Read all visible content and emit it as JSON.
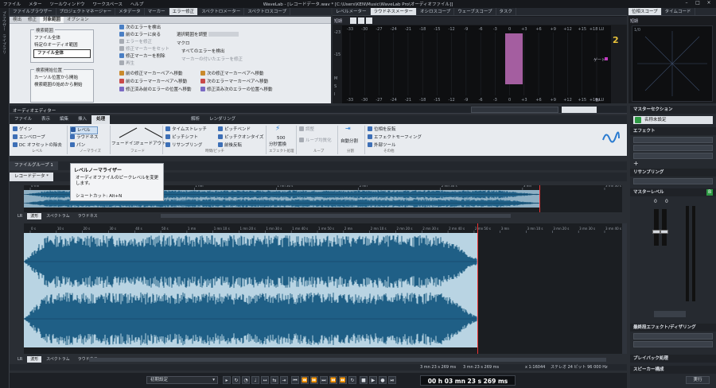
{
  "titlebar": {
    "menu": [
      "ファイル",
      "メター",
      "ツールウィンドウ",
      "ワークスペース",
      "ヘルプ"
    ],
    "title": "WaveLab - [レコードデータ.wav * [C:\\Users\\KEN\\Music\\WaveLab Pro\\オーディオファイル]]"
  },
  "leftrail": {
    "labels": [
      "ブラウザー",
      "ライブラリ"
    ]
  },
  "toppanel": {
    "tabs": [
      "ファイルブラウザー",
      "プロジェクトマネージャー",
      "メタデータ",
      "マーカー",
      "エラー修正",
      "スペクトロメーター",
      "スペクトロスコープ"
    ],
    "active_tab": "エラー修正",
    "subtabs": [
      "検出",
      "修正",
      "対象範囲",
      "オプション"
    ],
    "active_subtab": "対象範囲",
    "group1_title": "検索範囲",
    "group1_items": [
      "ファイル全体",
      "特定のオーディオ範囲",
      "ファイル全体"
    ],
    "group2_title": "検索開始位置",
    "group2_items": [
      "カーソル位置から開始",
      "検索範囲の始めから開始"
    ],
    "cmds_col1": [
      "次のエラーを検出",
      "前のエラーに戻る",
      "エラーを修正",
      "修正マーカーをセット",
      "修正マーカーを削除",
      "再生"
    ],
    "cmds_col2": [
      "選択範囲を調整",
      "マクロ",
      "すべてのエラーを検出",
      "マーカーの付いたエラーを修正"
    ],
    "cmds_bottom": [
      "前の修正マーカーペアへ移動",
      "次の修正マーカーペアへ移動",
      "前のエラーマーカーペアへ移動",
      "次のエラーマーカーペアへ移動",
      "修正済み前のエラーの位置へ移動",
      "修正済み次のエラーの位置へ移動"
    ]
  },
  "levelpanel": {
    "tabs": [
      "レベルメーター",
      "ラウドネスメーター",
      "オシロスコープ",
      "ウェーブスコープ",
      "タスク"
    ],
    "active_tab": "ラウドネスメーター",
    "label": "短期",
    "scale": [
      "-33",
      "-30",
      "-27",
      "-24",
      "-21",
      "-18",
      "-15",
      "-12",
      "-9",
      "-6",
      "-3",
      "0",
      "+3",
      "+6",
      "+9",
      "+12",
      "+15",
      "+18 LU"
    ],
    "gate": "ゲート",
    "lufs_badge": "2",
    "left_labels": [
      "-23",
      "-15",
      "M",
      "S",
      "I"
    ],
    "tp": "TP"
  },
  "phasepanel": {
    "tabs": [
      "位相スコープ",
      "タイムコード"
    ],
    "label": "短期",
    "value": "1/0"
  },
  "editor": {
    "title": "オーディオエディター",
    "ribbon_tabs": [
      "ファイル",
      "表示",
      "編集",
      "挿入",
      "処理",
      "解析",
      "レンダリング"
    ],
    "active_ribbon_tab": "処理",
    "ribbon_groups": [
      "レベル",
      "ノーマライズ",
      "フェード",
      "時間/ピッチ",
      "エフェクト処理",
      "ループ",
      "分割",
      "その他"
    ],
    "ribbon_items": {
      "level": [
        "ゲイン",
        "エンベロープ",
        "DC オフセットの除去"
      ],
      "normalize": [
        "レベル",
        "ラウドネス",
        "パン"
      ],
      "fade": [
        "フェードイン",
        "フェードアウト"
      ],
      "time": [
        "タイムストレッチ",
        "ピッチシフト",
        "リサンプリング"
      ],
      "pitch": [
        "ピッチベンド",
        "ピッチクオンタイズ",
        "前後反転"
      ],
      "effect": [
        "500",
        "分秒置換"
      ],
      "loop": [
        "調整",
        "ループ均質化"
      ],
      "split": [
        "自動分割"
      ],
      "other": [
        "位相を反転",
        "エフェクトモーフィング",
        "外部ツール"
      ]
    },
    "tooltip": {
      "title": "レベルノーマライザー",
      "desc": "オーディオファイルのピークレベルを変更します。",
      "shortcut": "ショートカット: Alt+N"
    },
    "file_group_tab": "ファイルグループ 1",
    "file_tab": "レコードデータ *",
    "overview_ticks": [
      "0 mn",
      "30 s",
      "1 mn",
      "1 mn 30 s",
      "2 mn",
      "2 mn 30 s",
      "3 mn",
      "3 mn 30 s"
    ],
    "main_ticks": [
      "0 s",
      "10 s",
      "20 s",
      "30 s",
      "40 s",
      "50 s",
      "1 mn",
      "1 mn 10 s",
      "1 mn 20 s",
      "1 mn 30 s",
      "1 mn 40 s",
      "1 mn 50 s",
      "2 mn",
      "2 mn 10 s",
      "2 mn 20 s",
      "2 mn 30 s",
      "2 mn 40 s",
      "2 mn 50 s",
      "3 mn",
      "3 mn 10 s",
      "3 mn 20 s",
      "3 mn 30 s",
      "3 mn 40 s"
    ],
    "view_tabs": [
      "波形",
      "スペクトラム",
      "ラウドネス"
    ],
    "active_view_tab": "波形",
    "status": {
      "pos": "3 mn 23 s 269 ms",
      "len": "3 mn 23 s 269 ms",
      "zoom": "x 1:16044",
      "format": "ステレオ 24 ビット 96 000 Hz"
    },
    "preset": "初期設定",
    "timecode": "00 h 03 mn 23 s 269 ms"
  },
  "master": {
    "title": "マスターセクション",
    "preset": "名称未設定",
    "effects": "エフェクト",
    "resampling": "リサンプリング",
    "level": "マスターレベル",
    "level_values": [
      "0",
      "0"
    ],
    "final": "最終段エフェクト/ディザリング",
    "playback": "プレイバック処理",
    "speaker": "スピーカー構成",
    "render": "実行"
  },
  "colors": {
    "wave": "#1f5f86",
    "wave_bg": "#b9d4e3",
    "cursor": "#e33333",
    "peak": "#a45ea0",
    "accent": "#2e9a44"
  }
}
